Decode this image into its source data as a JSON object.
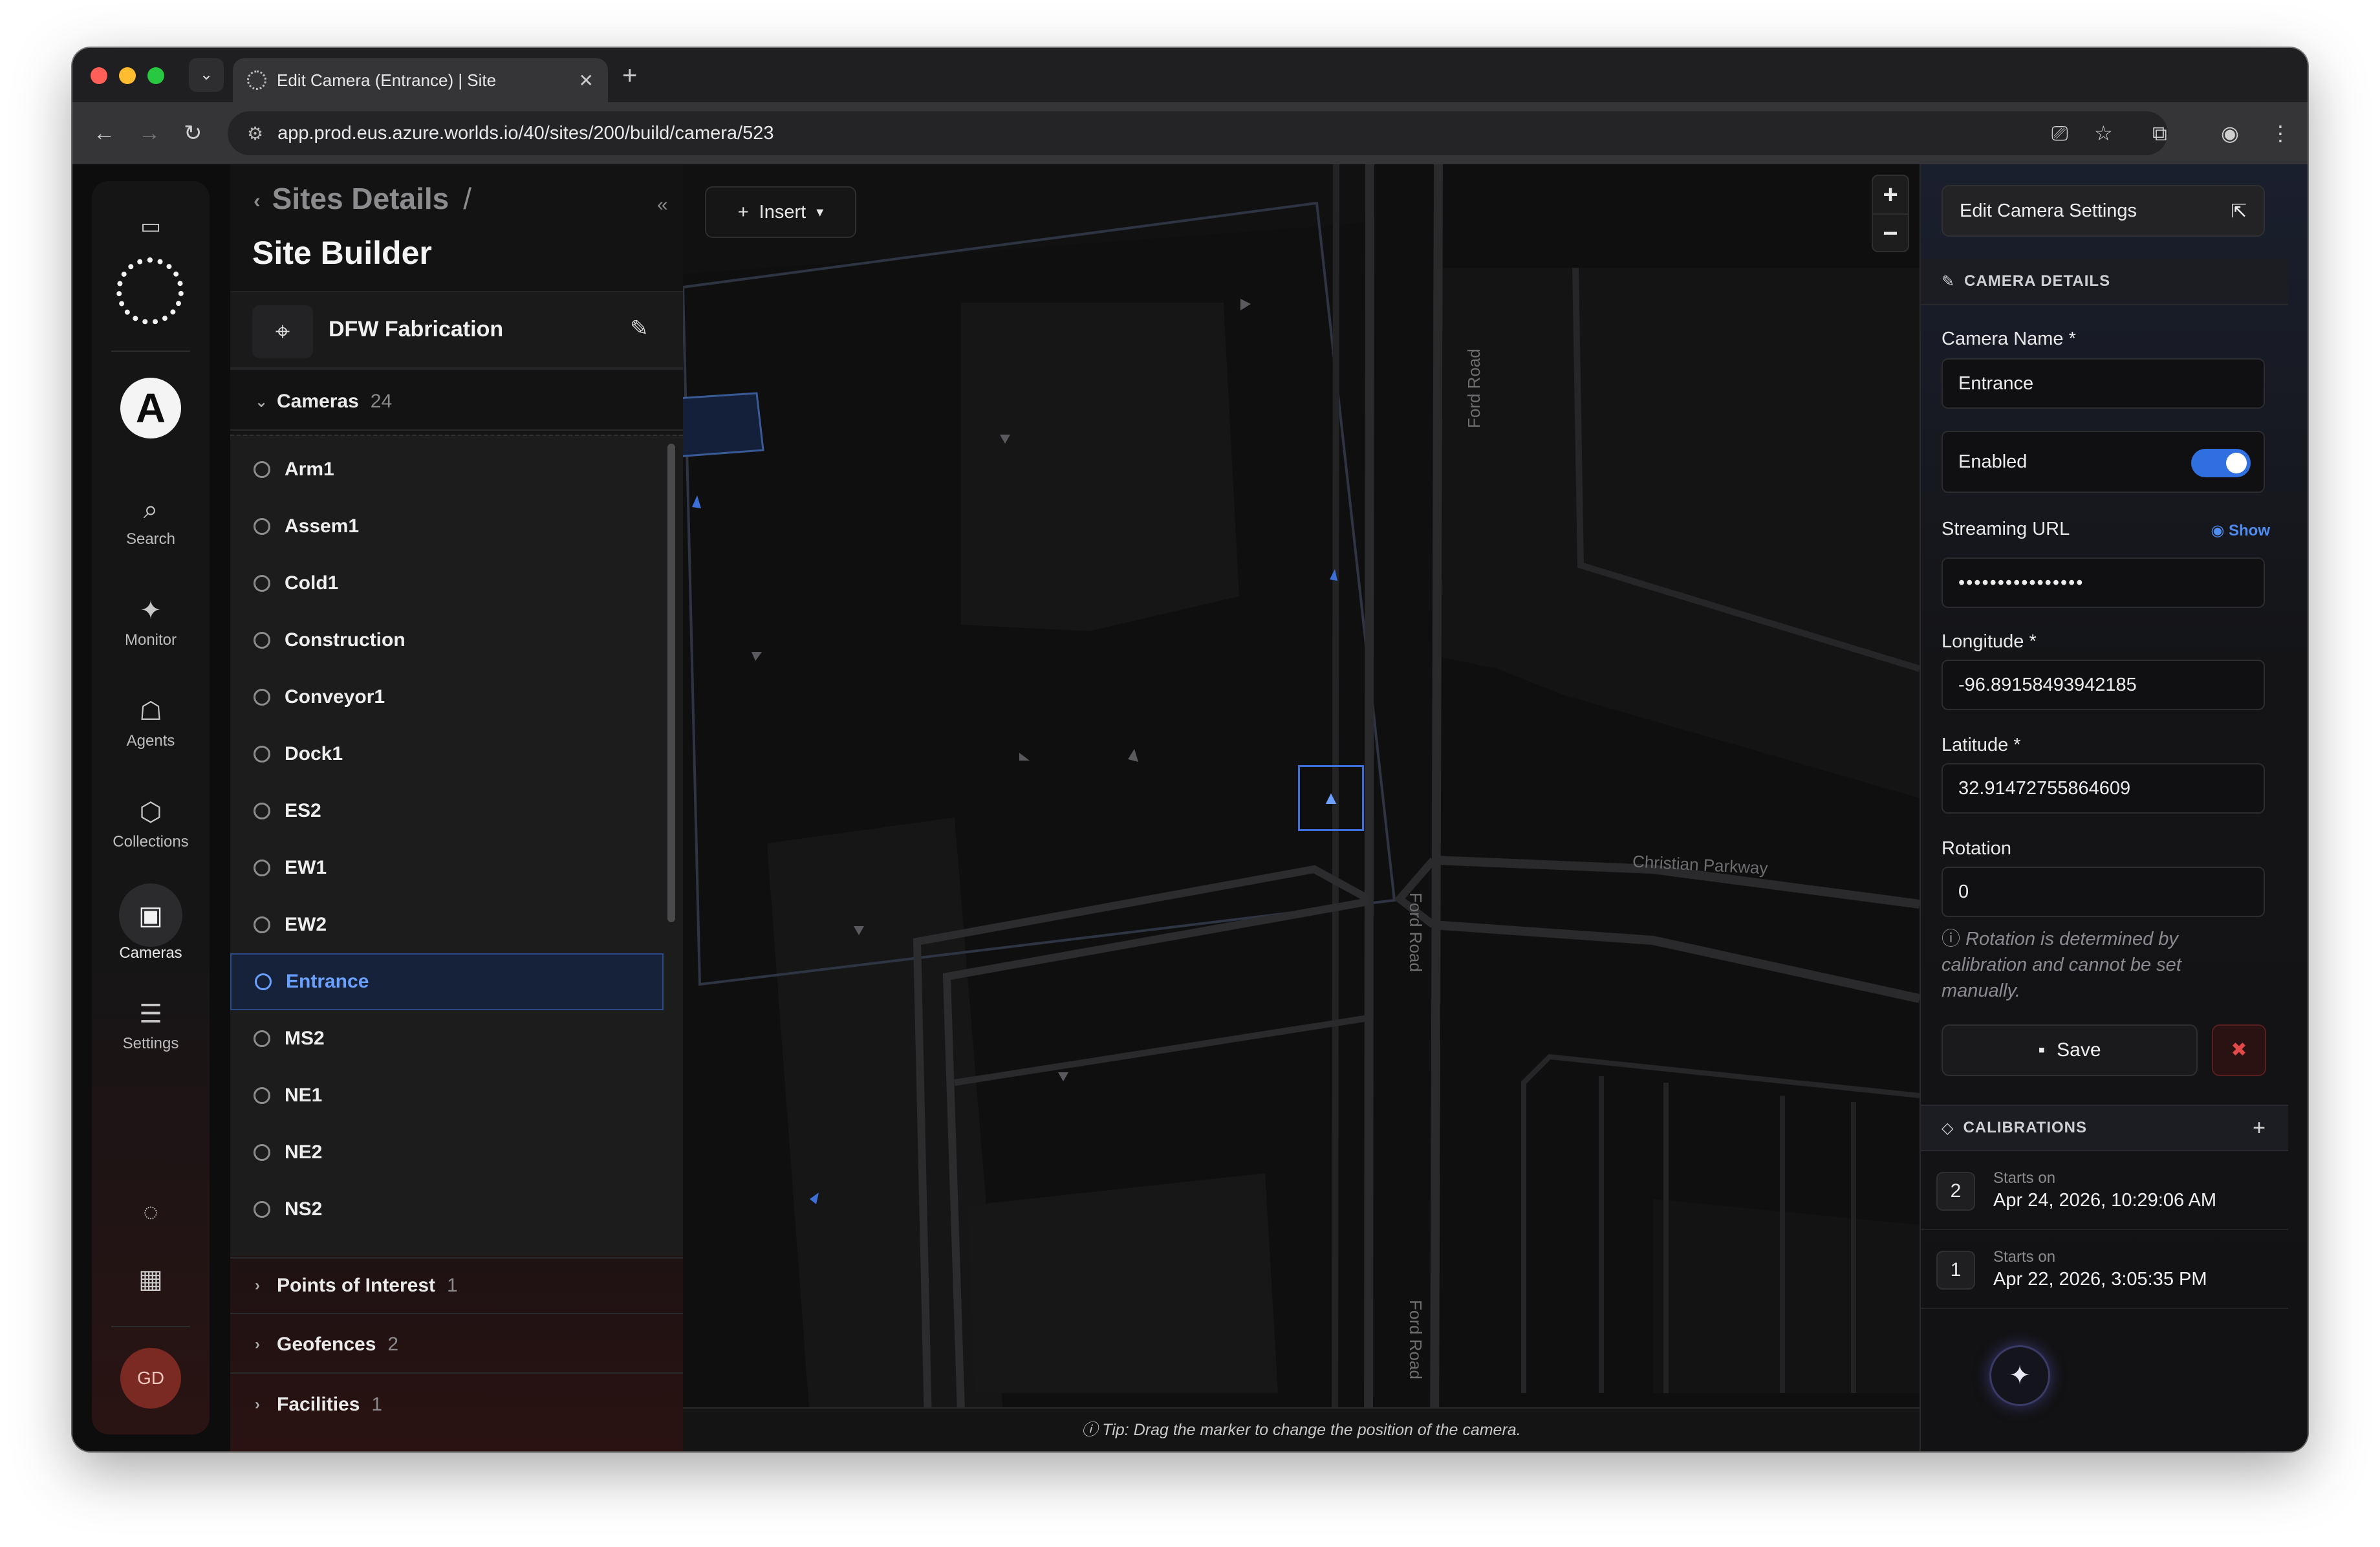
{
  "browser": {
    "tab_title": "Edit Camera (Entrance) | Site",
    "url": "app.prod.eus.azure.worlds.io/40/sites/200/build/camera/523"
  },
  "rail": {
    "items": [
      {
        "label": "Search",
        "icon": "search-icon"
      },
      {
        "label": "Monitor",
        "icon": "monitor-icon"
      },
      {
        "label": "Agents",
        "icon": "robot-icon"
      },
      {
        "label": "Collections",
        "icon": "cube-icon"
      },
      {
        "label": "Cameras",
        "icon": "camera-icon"
      },
      {
        "label": "Settings",
        "icon": "sliders-icon"
      }
    ],
    "avatar_initials": "GD"
  },
  "panel": {
    "breadcrumb": "Sites Details",
    "title": "Site Builder",
    "site_name": "DFW Fabrication",
    "cameras_label": "Cameras",
    "cameras_count": "24",
    "cameras": [
      "Arm1",
      "Assem1",
      "Cold1",
      "Construction",
      "Conveyor1",
      "Dock1",
      "ES2",
      "EW1",
      "EW2",
      "Entrance",
      "MS2",
      "NE1",
      "NE2",
      "NS2"
    ],
    "selected_camera": "Entrance",
    "sections": [
      {
        "label": "Points of Interest",
        "count": "1"
      },
      {
        "label": "Geofences",
        "count": "2"
      },
      {
        "label": "Facilities",
        "count": "1"
      }
    ]
  },
  "map": {
    "insert_label": "Insert",
    "streets": [
      "Ford Road",
      "Ford Road",
      "Ford Road",
      "Christian Parkway"
    ],
    "tip": "Tip: Drag the marker to change the position of the camera."
  },
  "editor": {
    "edit_settings_label": "Edit Camera Settings",
    "camera_details_header": "CAMERA DETAILS",
    "camera_name_label": "Camera Name *",
    "camera_name_value": "Entrance",
    "enabled_label": "Enabled",
    "enabled": true,
    "streaming_url_label": "Streaming URL",
    "show_label": "Show",
    "streaming_url_value": "••••••••••••••••",
    "longitude_label": "Longitude *",
    "longitude_value": "-96.89158493942185",
    "latitude_label": "Latitude *",
    "latitude_value": "32.91472755864609",
    "rotation_label": "Rotation",
    "rotation_value": "0",
    "rotation_hint": "Rotation is determined by calibration and cannot be set manually.",
    "save_label": "Save",
    "calibrations_header": "CALIBRATIONS",
    "calibrations": [
      {
        "num": "2",
        "sub": "Starts on",
        "date": "Apr 24, 2026, 10:29:06 AM"
      },
      {
        "num": "1",
        "sub": "Starts on",
        "date": "Apr 22, 2026, 3:05:35 PM"
      }
    ]
  },
  "colors": {
    "accent": "#2f6fe0",
    "selected_text": "#6aa0ff",
    "danger": "#e24a4a"
  }
}
